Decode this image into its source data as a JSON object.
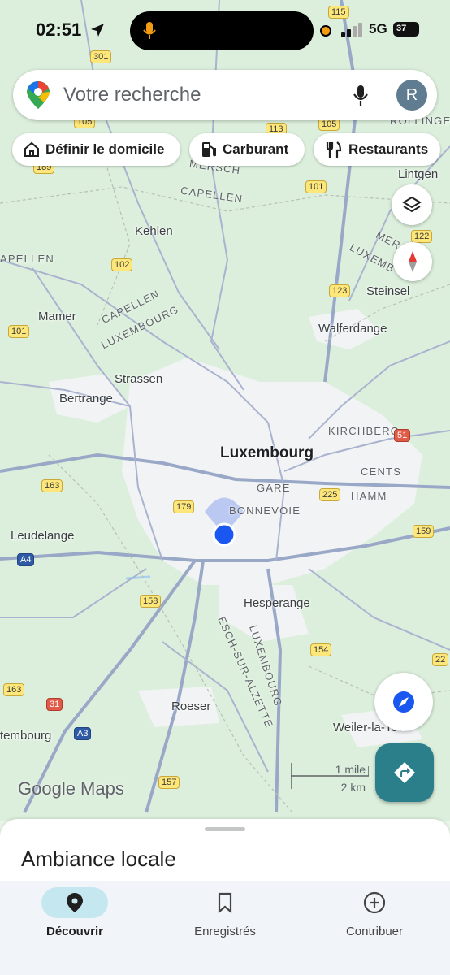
{
  "status_bar": {
    "time": "02:51",
    "network": "5G",
    "battery": "37"
  },
  "search": {
    "placeholder": "Votre recherche",
    "avatar_initial": "R"
  },
  "chips": [
    {
      "label": "Définir le domicile",
      "icon": "home-icon"
    },
    {
      "label": "Carburant",
      "icon": "fuel-pump-icon"
    },
    {
      "label": "Restaurants",
      "icon": "fork-knife-icon"
    }
  ],
  "map": {
    "places": [
      "Kehlen",
      "Mamer",
      "Strassen",
      "Bertrange",
      "Leudelange",
      "Walferdange",
      "Steinsel",
      "Lintgen",
      "Hesperange",
      "Roeser",
      "Weiler-la-Tour",
      "ROLLINGEN",
      "tembourg",
      "APELLEN"
    ],
    "city": "Luxembourg",
    "districts": [
      "MERSCH",
      "CAPELLEN",
      "CAPELLEN",
      "LUXEMBOURG",
      "KIRCHBERG",
      "CENTS",
      "GARE",
      "HAMM",
      "BONNEVOIE",
      "MER",
      "LUXEMB",
      "ESCH-SUR-ALZETTE",
      "LUXEMBOURG"
    ],
    "route_shields": [
      "115",
      "301",
      "105",
      "105",
      "113",
      "189",
      "101",
      "102",
      "122",
      "123",
      "101",
      "51",
      "163",
      "179",
      "225",
      "159",
      "A4",
      "158",
      "154",
      "163",
      "31",
      "A3",
      "157",
      "22"
    ],
    "branding": "Google Maps",
    "scale": {
      "imperial": "1 mile",
      "metric": "2 km"
    }
  },
  "sheet": {
    "title": "Ambiance locale"
  },
  "nav": [
    {
      "label": "Découvrir",
      "icon": "location-pin-icon",
      "active": true
    },
    {
      "label": "Enregistrés",
      "icon": "bookmark-icon",
      "active": false
    },
    {
      "label": "Contribuer",
      "icon": "plus-circle-icon",
      "active": false
    }
  ],
  "colors": {
    "accent": "#2b7f8a",
    "active_nav_bg": "#c4e7f0",
    "user_location": "#1a57f0"
  }
}
